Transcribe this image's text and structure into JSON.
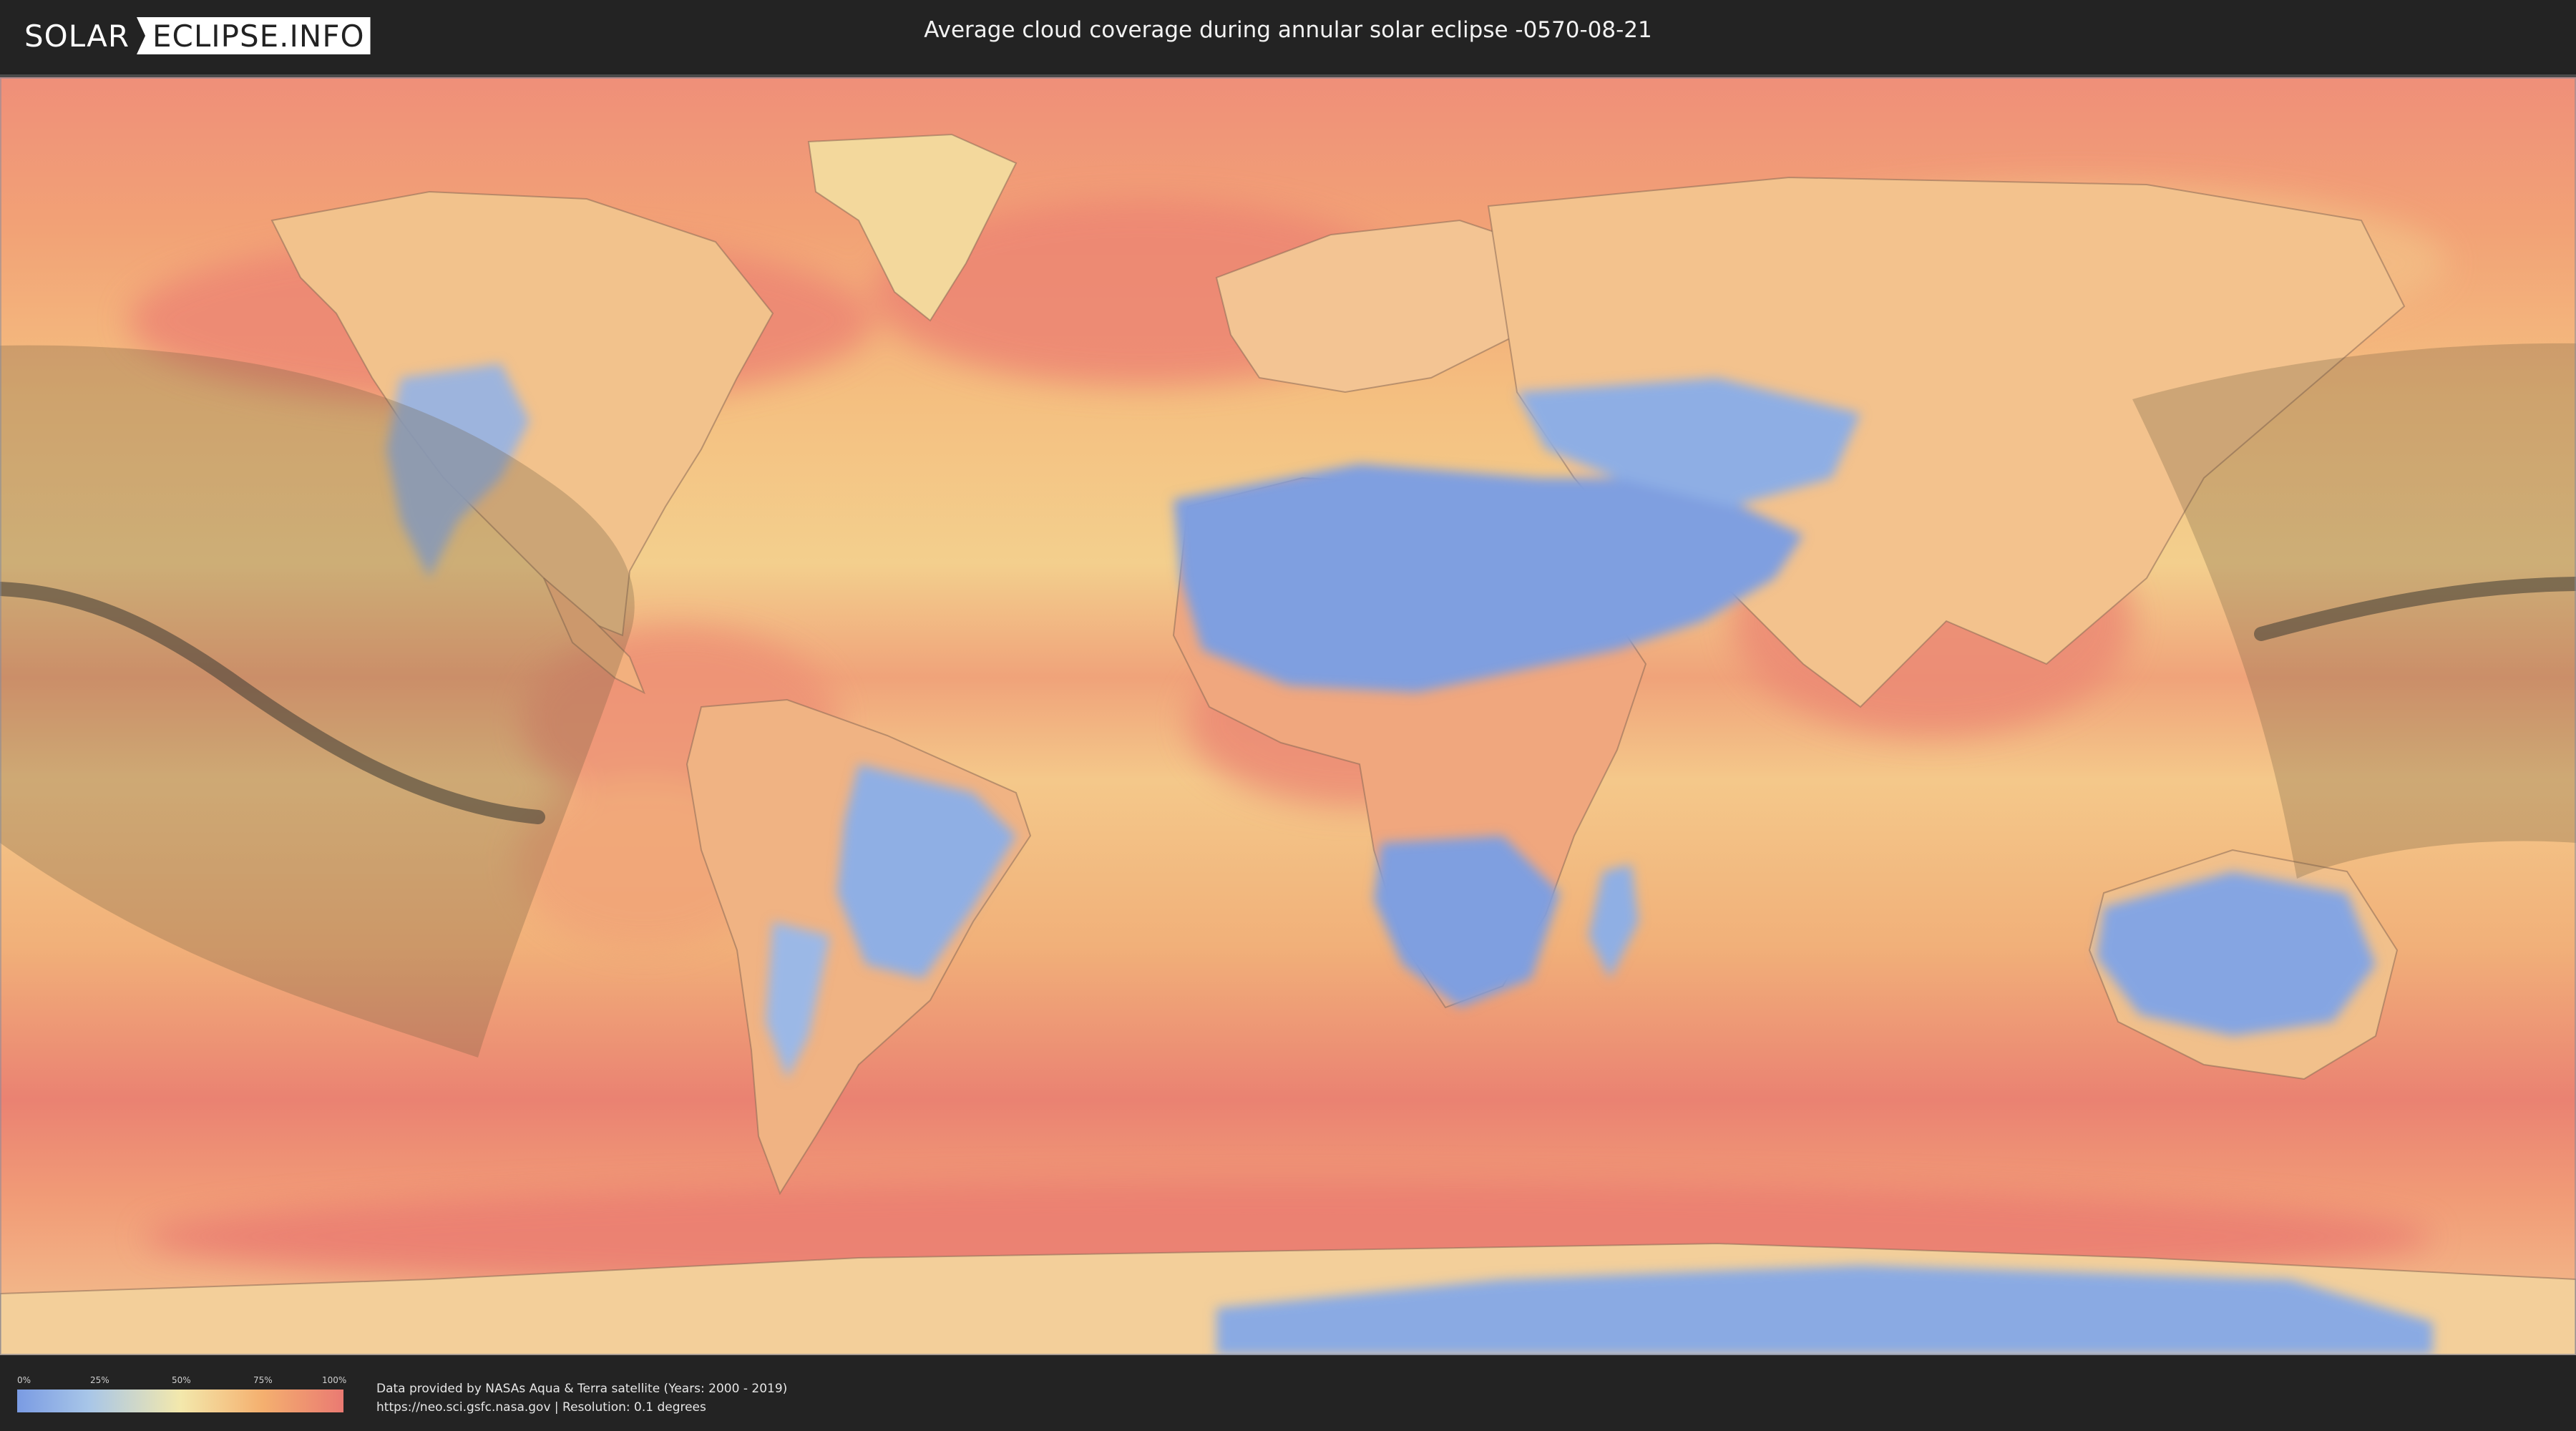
{
  "header": {
    "logo_left": "SOLAR",
    "logo_right": "ECLIPSE.INFO",
    "title": "Average cloud coverage during annular solar eclipse -0570-08-21"
  },
  "map": {
    "type": "cloud-coverage-world-map",
    "projection": "equirectangular",
    "eclipse_type": "annular",
    "eclipse_date": "-0570-08-21",
    "colors": {
      "clear": "#7a9be3",
      "low": "#a8c6e8",
      "mid": "#f3e8ac",
      "high": "#f4b06f",
      "overcast": "#ea7a72",
      "penumbra_shade": "#6b5a3e",
      "central_path": "#4a4238"
    }
  },
  "legend": {
    "ticks": [
      "0%",
      "25%",
      "50%",
      "75%",
      "100%"
    ]
  },
  "footer": {
    "line1": "Data provided by NASAs Aqua & Terra satellite (Years: 2000 - 2019)",
    "line2": "https://neo.sci.gsfc.nasa.gov | Resolution: 0.1 degrees"
  }
}
